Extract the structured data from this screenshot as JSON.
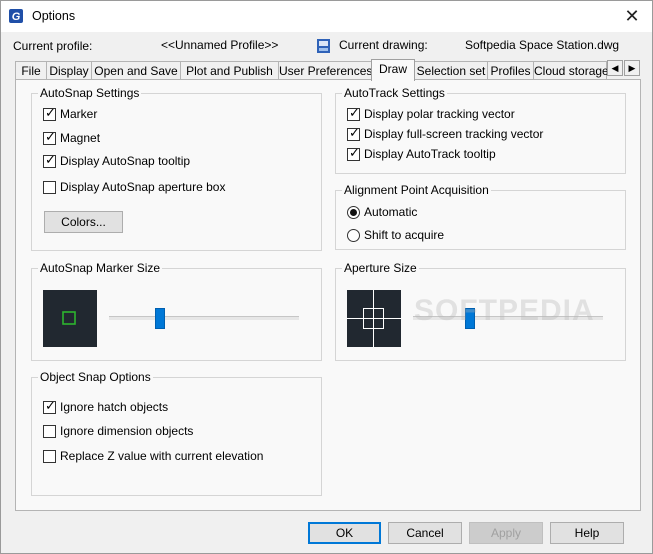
{
  "window": {
    "title": "Options",
    "close_icon": "close-icon",
    "app_icon": "g-app-icon"
  },
  "profile": {
    "label": "Current profile:",
    "value": "<<Unnamed Profile>>",
    "drawing_label": "Current drawing:",
    "drawing_value": "Softpedia Space Station.dwg",
    "drawing_icon": "drawing-file-icon"
  },
  "tabs": [
    {
      "label": "File"
    },
    {
      "label": "Display"
    },
    {
      "label": "Open and Save"
    },
    {
      "label": "Plot and Publish"
    },
    {
      "label": "User Preferences"
    },
    {
      "label": "Draw",
      "active": true
    },
    {
      "label": "Selection set"
    },
    {
      "label": "Profiles"
    },
    {
      "label": "Cloud storage"
    }
  ],
  "tab_scroll": {
    "left": "◀",
    "right": "▶"
  },
  "autosnap": {
    "title": "AutoSnap Settings",
    "options": [
      {
        "label": "Marker",
        "checked": true
      },
      {
        "label": "Magnet",
        "checked": true
      },
      {
        "label": "Display AutoSnap tooltip",
        "checked": true
      },
      {
        "label": "Display AutoSnap aperture box",
        "checked": false
      }
    ],
    "colors_button": "Colors..."
  },
  "autotrack": {
    "title": "AutoTrack Settings",
    "options": [
      {
        "label": "Display polar tracking vector",
        "checked": true
      },
      {
        "label": "Display full-screen tracking vector",
        "checked": true
      },
      {
        "label": "Display AutoTrack tooltip",
        "checked": true
      }
    ]
  },
  "alignment": {
    "title": "Alignment Point Acquisition",
    "options": [
      {
        "label": "Automatic",
        "selected": true
      },
      {
        "label": "Shift to acquire",
        "selected": false
      }
    ]
  },
  "marker_size": {
    "title": "AutoSnap Marker Size",
    "level": 0.27
  },
  "aperture_size": {
    "title": "Aperture Size",
    "level": 0.3
  },
  "object_snap": {
    "title": "Object Snap Options",
    "options": [
      {
        "label": "Ignore hatch objects",
        "checked": true
      },
      {
        "label": "Ignore dimension objects",
        "checked": false
      },
      {
        "label": "Replace Z value with current elevation",
        "checked": false
      }
    ]
  },
  "buttons": {
    "ok": "OK",
    "cancel": "Cancel",
    "apply": "Apply",
    "help": "Help"
  },
  "watermark": "SOFTPEDIA",
  "colors": {
    "accent": "#0078d7",
    "preview_bg": "#212830",
    "marker": "#2db52d"
  }
}
